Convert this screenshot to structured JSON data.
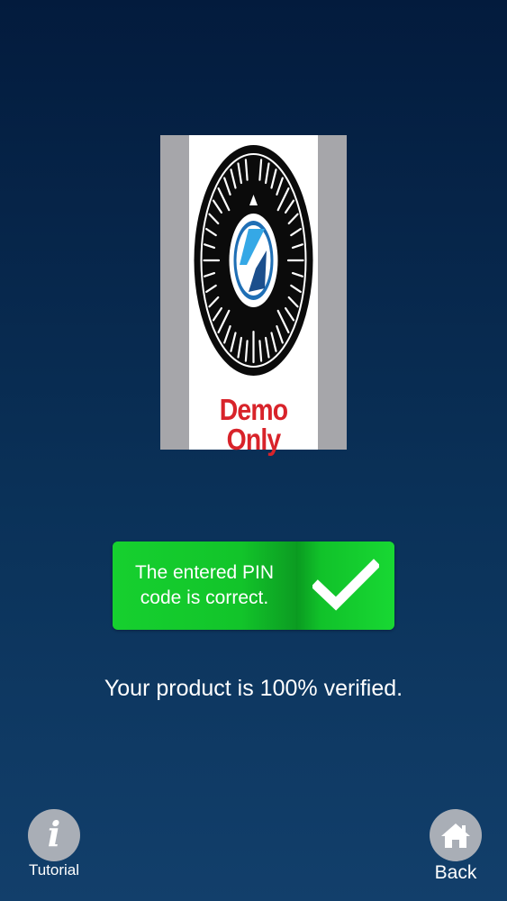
{
  "product": {
    "demo_label": "Demo Only"
  },
  "status": {
    "message": "The entered PIN code is correct.",
    "icon": "checkmark-icon",
    "color": "#12c82a"
  },
  "verification": {
    "message": "Your product is 100% verified."
  },
  "nav": {
    "tutorial_label": "Tutorial",
    "tutorial_icon": "info-icon",
    "back_label": "Back",
    "back_icon": "home-icon"
  }
}
